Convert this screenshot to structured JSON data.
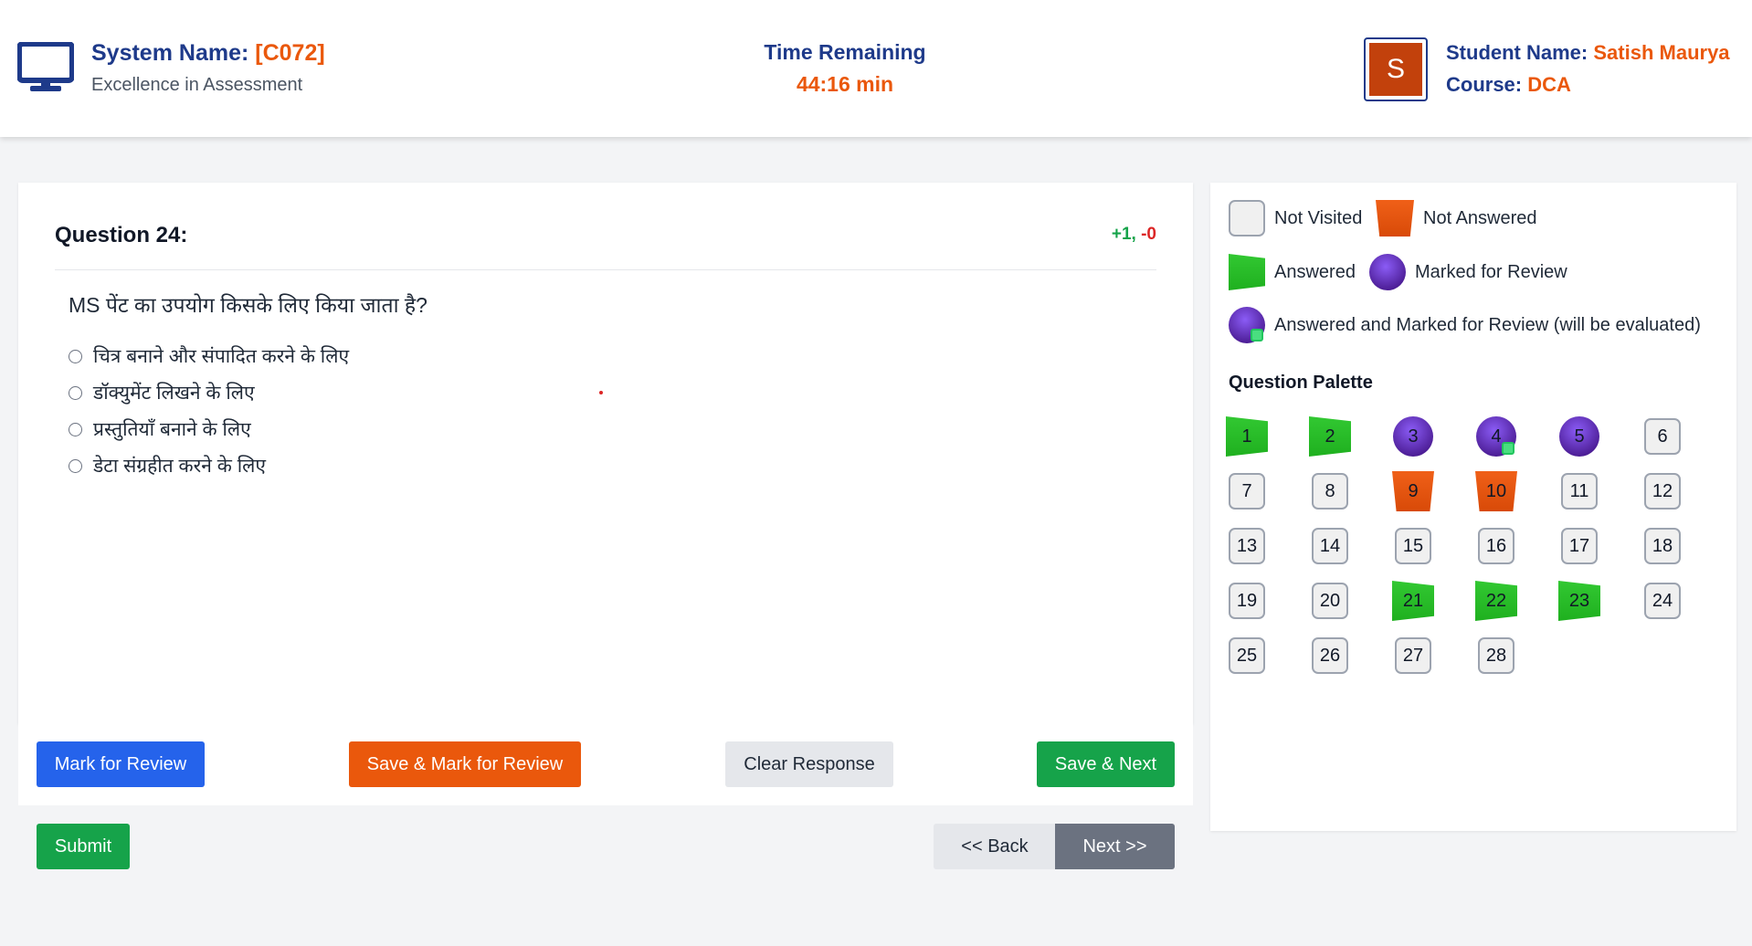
{
  "header": {
    "system_label": "System Name:",
    "system_code": "[C072]",
    "tagline": "Excellence in Assessment",
    "time_label": "Time Remaining",
    "time_value": "44:16 min",
    "avatar_letter": "S",
    "student_label": "Student Name:",
    "student_name": "Satish Maurya",
    "course_label": "Course:",
    "course_value": "DCA"
  },
  "question": {
    "number_label": "Question 24:",
    "marks_positive": "+1,",
    "marks_negative": "-0",
    "text": "MS पेंट का उपयोग किसके लिए किया जाता है?",
    "options": [
      "चित्र बनाने और संपादित करने के लिए",
      "डॉक्युमेंट लिखने के लिए",
      "प्रस्तुतियाँ बनाने के लिए",
      "डेटा संग्रहीत करने के लिए"
    ]
  },
  "actions": {
    "mark_review": "Mark for Review",
    "save_mark_review": "Save & Mark for Review",
    "clear_response": "Clear Response",
    "save_next": "Save & Next",
    "submit": "Submit",
    "back": "<< Back",
    "next": "Next >>"
  },
  "legend": {
    "not_visited": "Not Visited",
    "not_answered": "Not Answered",
    "answered": "Answered",
    "marked_review": "Marked for Review",
    "answered_marked": "Answered and Marked for Review (will be evaluated)"
  },
  "palette": {
    "title": "Question Palette",
    "items": [
      {
        "n": "1",
        "status": "answered"
      },
      {
        "n": "2",
        "status": "answered"
      },
      {
        "n": "3",
        "status": "marked"
      },
      {
        "n": "4",
        "status": "answered-marked"
      },
      {
        "n": "5",
        "status": "marked"
      },
      {
        "n": "6",
        "status": "not-visited"
      },
      {
        "n": "7",
        "status": "not-visited"
      },
      {
        "n": "8",
        "status": "not-visited"
      },
      {
        "n": "9",
        "status": "not-answered"
      },
      {
        "n": "10",
        "status": "not-answered"
      },
      {
        "n": "11",
        "status": "not-visited"
      },
      {
        "n": "12",
        "status": "not-visited"
      },
      {
        "n": "13",
        "status": "not-visited"
      },
      {
        "n": "14",
        "status": "not-visited"
      },
      {
        "n": "15",
        "status": "not-visited"
      },
      {
        "n": "16",
        "status": "not-visited"
      },
      {
        "n": "17",
        "status": "not-visited"
      },
      {
        "n": "18",
        "status": "not-visited"
      },
      {
        "n": "19",
        "status": "not-visited"
      },
      {
        "n": "20",
        "status": "not-visited"
      },
      {
        "n": "21",
        "status": "answered"
      },
      {
        "n": "22",
        "status": "answered"
      },
      {
        "n": "23",
        "status": "answered"
      },
      {
        "n": "24",
        "status": "not-visited"
      },
      {
        "n": "25",
        "status": "not-visited"
      },
      {
        "n": "26",
        "status": "not-visited"
      },
      {
        "n": "27",
        "status": "not-visited"
      },
      {
        "n": "28",
        "status": "not-visited"
      }
    ]
  },
  "colors": {
    "brand_blue": "#1e3a8a",
    "accent_orange": "#ea580c",
    "answered_green": "#22c55e",
    "review_purple": "#5b21b6"
  }
}
